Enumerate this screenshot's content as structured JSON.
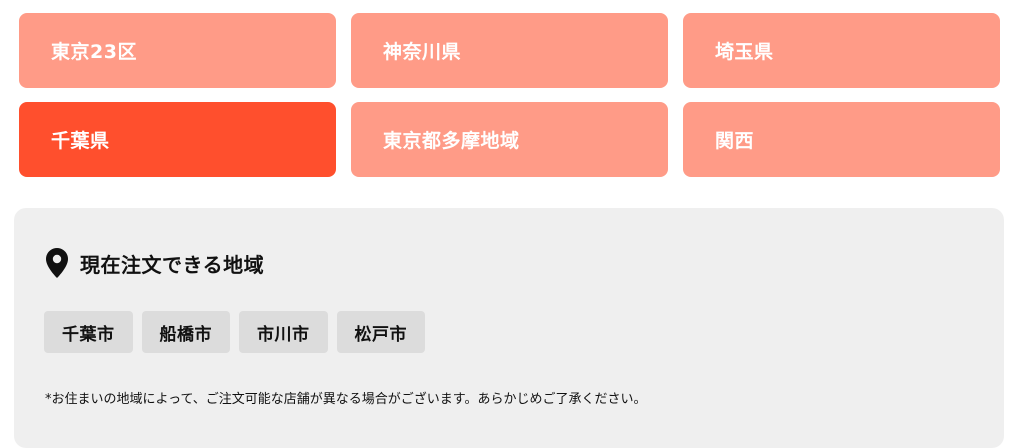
{
  "regions": [
    {
      "label": "東京23区",
      "active": false
    },
    {
      "label": "神奈川県",
      "active": false
    },
    {
      "label": "埼玉県",
      "active": false
    },
    {
      "label": "千葉県",
      "active": true
    },
    {
      "label": "東京都多摩地域",
      "active": false
    },
    {
      "label": "関西",
      "active": false
    }
  ],
  "panel": {
    "title": "現在注文できる地域",
    "icon": "map-pin-icon",
    "cities": [
      "千葉市",
      "船橋市",
      "市川市",
      "松戸市"
    ],
    "note": "*お住まいの地域によって、ご注文可能な店舗が異なる場合がございます。あらかじめご了承ください。"
  },
  "colors": {
    "region_inactive": "#ff9b87",
    "region_active": "#ff4f2d",
    "panel_bg": "#efefef",
    "chip_bg": "#dcdcdc"
  }
}
